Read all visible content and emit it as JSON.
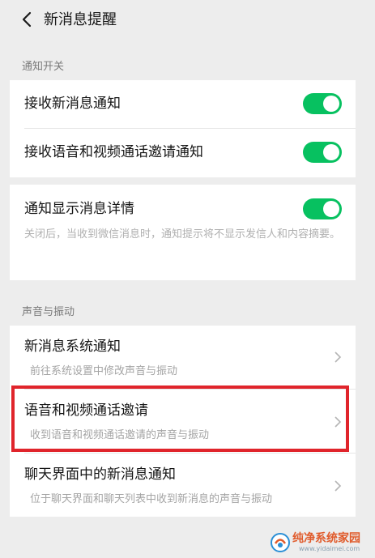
{
  "header": {
    "title": "新消息提醒"
  },
  "sections": {
    "notify_switch": "通知开关",
    "sound_vibrate": "声音与振动"
  },
  "rows": {
    "receive_new": "接收新消息通知",
    "receive_call": "接收语音和视频通话邀请通知",
    "show_detail": "通知显示消息详情",
    "show_detail_desc": "关闭后，当收到微信消息时，通知提示将不显示发信人和内容摘要。",
    "system_notify": "新消息系统通知",
    "system_notify_desc": "前往系统设置中修改声音与振动",
    "call_invite": "语音和视频通话邀请",
    "call_invite_desc": "收到语音和视频通话邀请的声音与振动",
    "chat_notify": "聊天界面中的新消息通知",
    "chat_notify_desc": "位于聊天界面和聊天列表中收到新消息的声音与振动"
  },
  "toggles": {
    "receive_new": true,
    "receive_call": true,
    "show_detail": true
  },
  "colors": {
    "toggle_on": "#07c160",
    "highlight_box": "#e0242b"
  },
  "watermark": {
    "text": "纯净系统家园",
    "url": "www.yidaimei.com"
  }
}
